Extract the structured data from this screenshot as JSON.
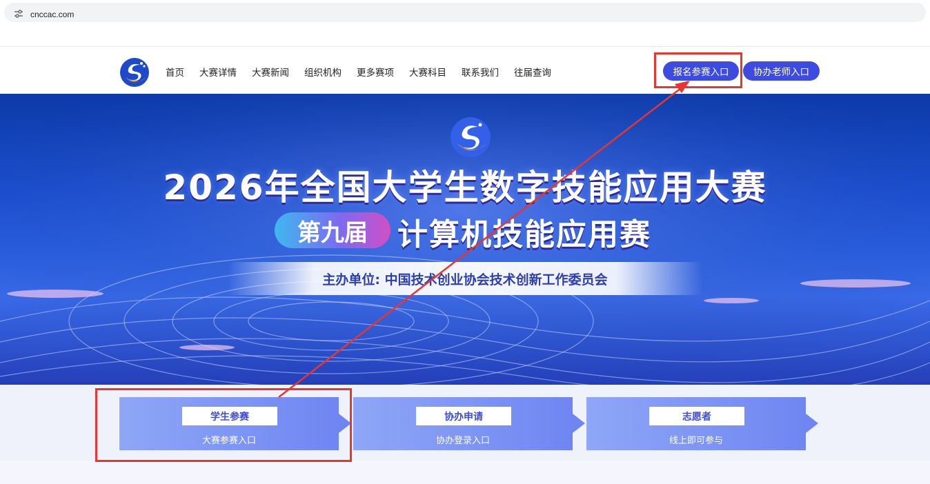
{
  "browser": {
    "url": "cnccac.com",
    "site_icon": "site-settings-icon"
  },
  "nav": {
    "logo_icon": "competition-logo-icon",
    "items": [
      "首页",
      "大赛详情",
      "大赛新闻",
      "组织机构",
      "更多赛项",
      "大赛科目",
      "联系我们",
      "往届查询"
    ],
    "signup_button": "报名参赛入口",
    "teacher_button": "协办老师入口"
  },
  "hero": {
    "title": "2026年全国大学生数字技能应用大赛",
    "edition_badge": "第九届",
    "edition_subtitle": "计算机技能应用赛",
    "organizer": "主办单位: 中国技术创业协会技术创新工作委员会"
  },
  "cards": [
    {
      "label": "学生参赛",
      "sub": "大赛参赛入口"
    },
    {
      "label": "协办申请",
      "sub": "协办登录入口"
    },
    {
      "label": "志愿者",
      "sub": "线上即可参与"
    }
  ],
  "colors": {
    "accent": "#3d4be0",
    "highlight": "#e8362f",
    "hero_blue": "#1d4fd0"
  }
}
